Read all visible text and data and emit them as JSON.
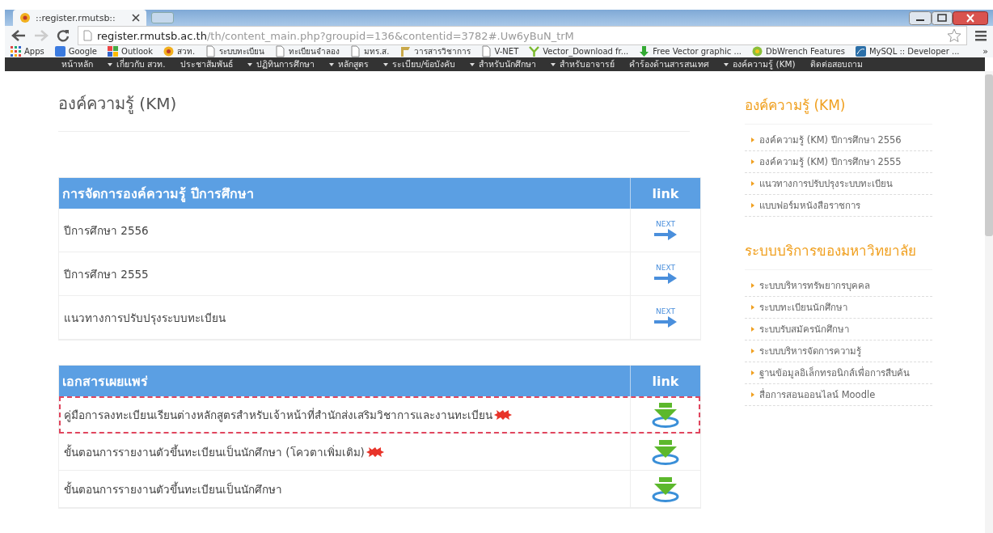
{
  "browser": {
    "tab_title": "::register.rmutsb::",
    "url_host": "register.rmutsb.ac.th",
    "url_path": "/th/content_main.php?groupid=136&contentid=3782#.Uw6yBuN_trM",
    "bookmarks": [
      {
        "label": "Apps",
        "kind": "apps"
      },
      {
        "label": "Google",
        "kind": "google"
      },
      {
        "label": "Outlook",
        "kind": "outlook"
      },
      {
        "label": "สวท.",
        "kind": "flower"
      },
      {
        "label": "ระบบทะเบียน",
        "kind": "page"
      },
      {
        "label": "ทะเบียนจำลอง",
        "kind": "page"
      },
      {
        "label": "มทร.ส.",
        "kind": "page"
      },
      {
        "label": "วารสารวิชาการ",
        "kind": "folder"
      },
      {
        "label": "V-NET",
        "kind": "page"
      },
      {
        "label": "Vector_Download fr...",
        "kind": "vector"
      },
      {
        "label": "Free Vector graphic ...",
        "kind": "download"
      },
      {
        "label": "DbWrench Features",
        "kind": "wrench"
      },
      {
        "label": "MySQL :: Developer ...",
        "kind": "mysql"
      }
    ],
    "more_label": "»"
  },
  "nav": [
    {
      "label": "หน้าหลัก",
      "has_menu": false
    },
    {
      "label": "เกี่ยวกับ สวท.",
      "has_menu": true
    },
    {
      "label": "ประชาสัมพันธ์",
      "has_menu": false
    },
    {
      "label": "ปฏิทินการศึกษา",
      "has_menu": true
    },
    {
      "label": "หลักสูตร",
      "has_menu": true
    },
    {
      "label": "ระเบียบ/ข้อบังคับ",
      "has_menu": true
    },
    {
      "label": "สำหรับนักศึกษา",
      "has_menu": true
    },
    {
      "label": "สำหรับอาจารย์",
      "has_menu": true
    },
    {
      "label": "คำร้องด้านสารสนเทศ",
      "has_menu": false
    },
    {
      "label": "องค์ความรู้ (KM)",
      "has_menu": true
    },
    {
      "label": "ติดต่อสอบถาม",
      "has_menu": false
    }
  ],
  "page_title": "องค์ความรู้ (KM)",
  "sections": [
    {
      "title": "การจัดการองค์ความรู้ ปีการศึกษา",
      "link_header": "link",
      "rows": [
        {
          "label": "ปีการศึกษา 2556",
          "kind": "next",
          "action_label": "NEXT",
          "is_new": false,
          "highlighted": false
        },
        {
          "label": "ปีการศึกษา 2555",
          "kind": "next",
          "action_label": "NEXT",
          "is_new": false,
          "highlighted": false
        },
        {
          "label": "แนวทางการปรับปรุงระบบทะเบียน",
          "kind": "next",
          "action_label": "NEXT",
          "is_new": false,
          "highlighted": false
        }
      ]
    },
    {
      "title": "เอกสารเผยแพร่",
      "link_header": "link",
      "rows": [
        {
          "label": "คู่มือการลงทะเบียนเรียนต่างหลักสูตรสำหรับเจ้าหน้าที่สำนักส่งเสริมวิชาการและงานทะเบียน",
          "kind": "download",
          "is_new": true,
          "highlighted": true
        },
        {
          "label": "ขั้นตอนการรายงานตัวขึ้นทะเบียนเป็นนักศึกษา (โควตาเพิ่มเติม)",
          "kind": "download",
          "is_new": true,
          "highlighted": false
        },
        {
          "label": "ขั้นตอนการรายงานตัวขึ้นทะเบียนเป็นนักศึกษา",
          "kind": "download",
          "is_new": false,
          "highlighted": false
        }
      ]
    }
  ],
  "sidebar": [
    {
      "title": "องค์ความรู้ (KM)",
      "items": [
        "องค์ความรู้ (KM) ปีการศึกษา 2556",
        "องค์ความรู้ (KM) ปีการศึกษา 2555",
        "แนวทางการปรับปรุงระบบทะเบียน",
        "แบบฟอร์มหนังสือราชการ"
      ]
    },
    {
      "title": "ระบบบริการของมหาวิทยาลัย",
      "items": [
        "ระบบบริหารทรัพยากรบุคคล",
        "ระบบทะเบียนนักศึกษา",
        "ระบบรับสมัครนักศึกษา",
        "ระบบบริหารจัดการความรู้",
        "ฐานข้อมูลอิเล็กทรอนิกส์เพื่อการสืบค้น",
        "สื่อการสอนออนไลน์ Moodle"
      ]
    }
  ]
}
